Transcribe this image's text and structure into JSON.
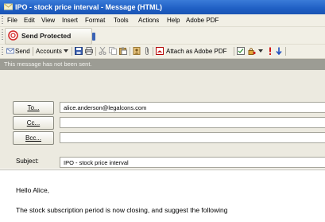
{
  "window": {
    "title": "IPO - stock price interval - Message (HTML)"
  },
  "menu": {
    "items": [
      "File",
      "Edit",
      "View",
      "Insert",
      "Format",
      "Tools",
      "Actions",
      "Help",
      "Adobe PDF"
    ]
  },
  "protect_bar": {
    "button_label": "Send Protected"
  },
  "toolbar": {
    "send_label": "Send",
    "accounts_label": "Accounts",
    "attach_pdf_label": "Attach as Adobe PDF"
  },
  "infobar": {
    "text": "This message has not been sent."
  },
  "headers": {
    "to_button": "To...",
    "cc_button": "Cc...",
    "bcc_button": "Bcc...",
    "subject_label": "Subject:",
    "to_value": "alice.anderson@legalcons.com",
    "cc_value": "",
    "bcc_value": "",
    "subject_value": "IPO - stock price interval"
  },
  "body": {
    "line1": "Hello Alice,",
    "line2": "The stock subscription period is now closing, and suggest the following"
  },
  "colors": {
    "titlebar": "#1f5fc4",
    "infobar": "#9c9c94",
    "chrome": "#f1efe5"
  }
}
